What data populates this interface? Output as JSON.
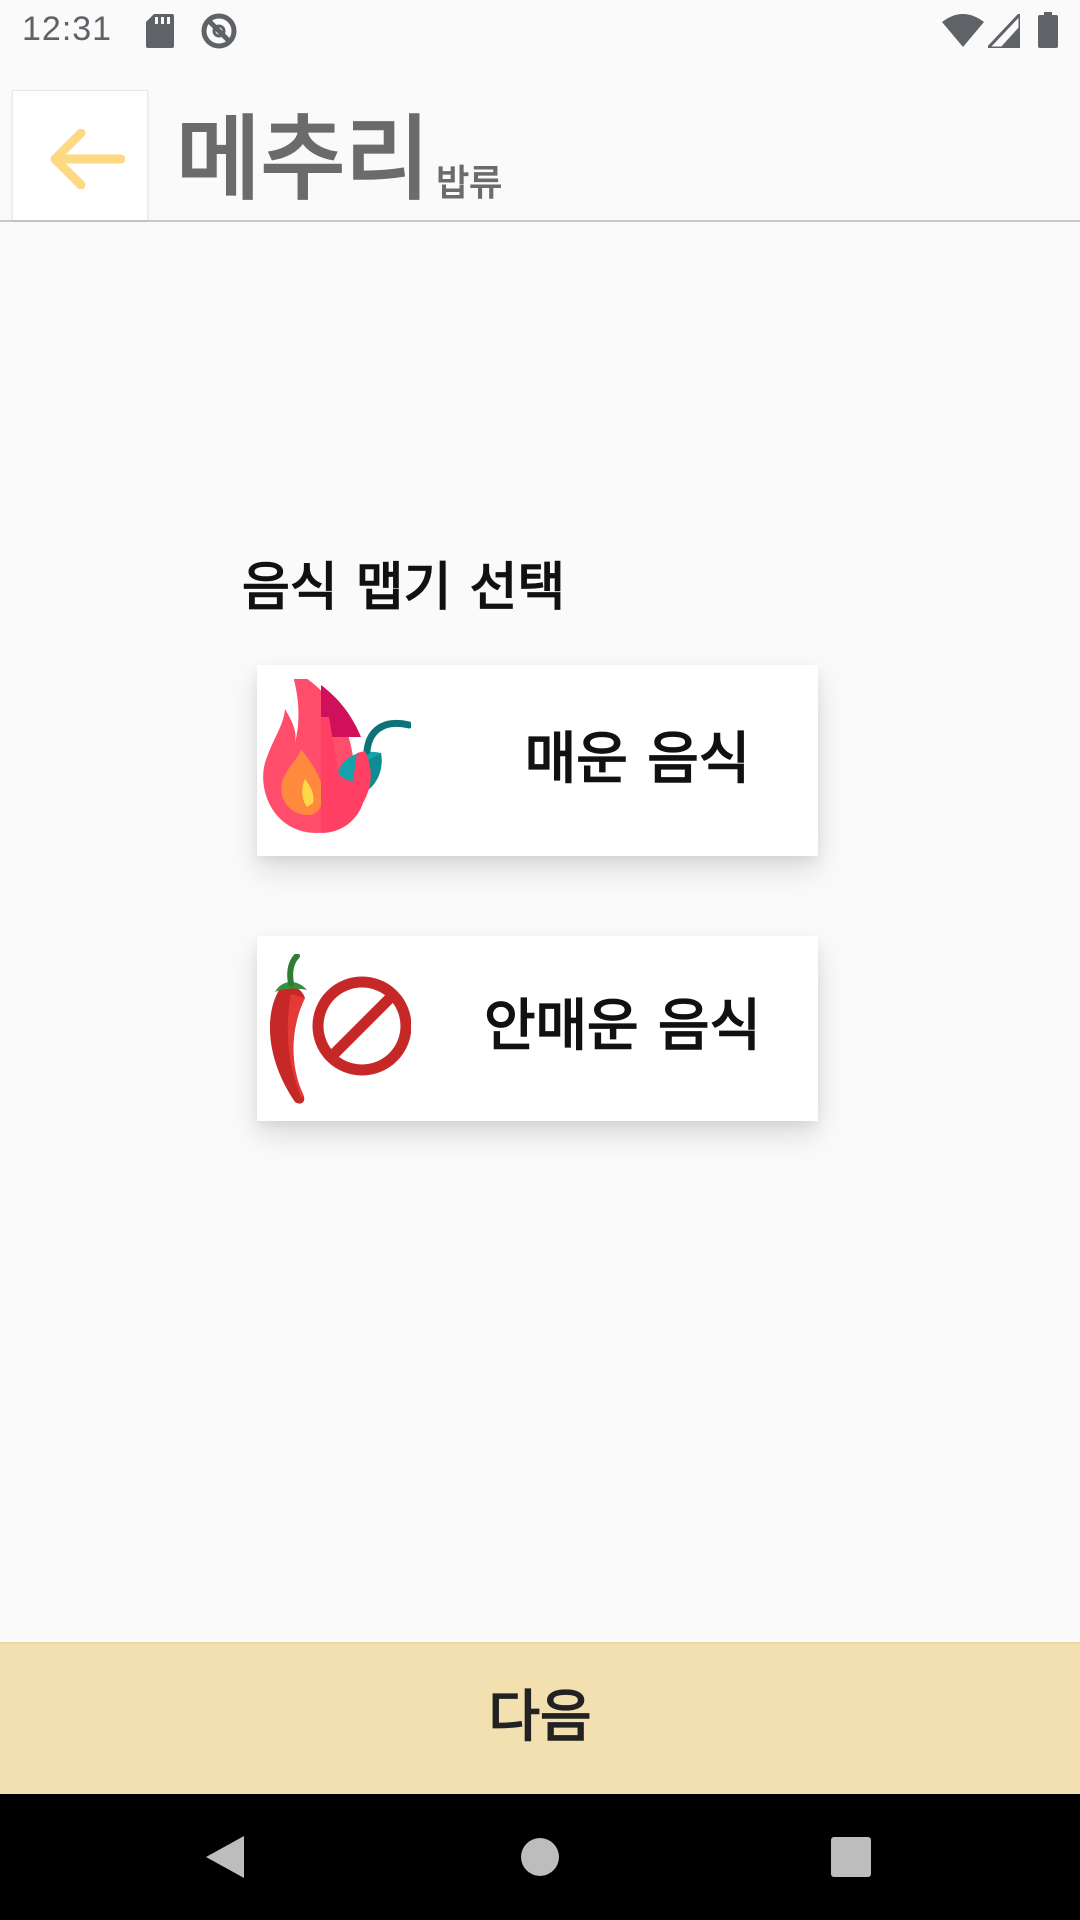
{
  "status_bar": {
    "time": "12:31",
    "icons": [
      "sd-card-icon",
      "do-not-disturb-icon",
      "wifi-icon",
      "cellular-signal-icon",
      "battery-icon"
    ]
  },
  "app_bar": {
    "back_icon": "arrow-left-icon",
    "title": "메추리",
    "subtitle": "밥류"
  },
  "main": {
    "section_title": "음식 맵기 선택",
    "options": [
      {
        "label": "매운 음식",
        "icon": "spicy-flame-pepper-icon"
      },
      {
        "label": "안매운 음식",
        "icon": "no-chili-icon"
      }
    ]
  },
  "footer": {
    "next_label": "다음"
  },
  "nav_bar": {
    "icons": [
      "back-triangle-icon",
      "home-circle-icon",
      "recents-square-icon"
    ]
  },
  "colors": {
    "background": "#fafafa",
    "accent_yellow": "#fcd982",
    "next_button_bg": "#f3e0b0",
    "title_gray": "#6b6b6b"
  }
}
